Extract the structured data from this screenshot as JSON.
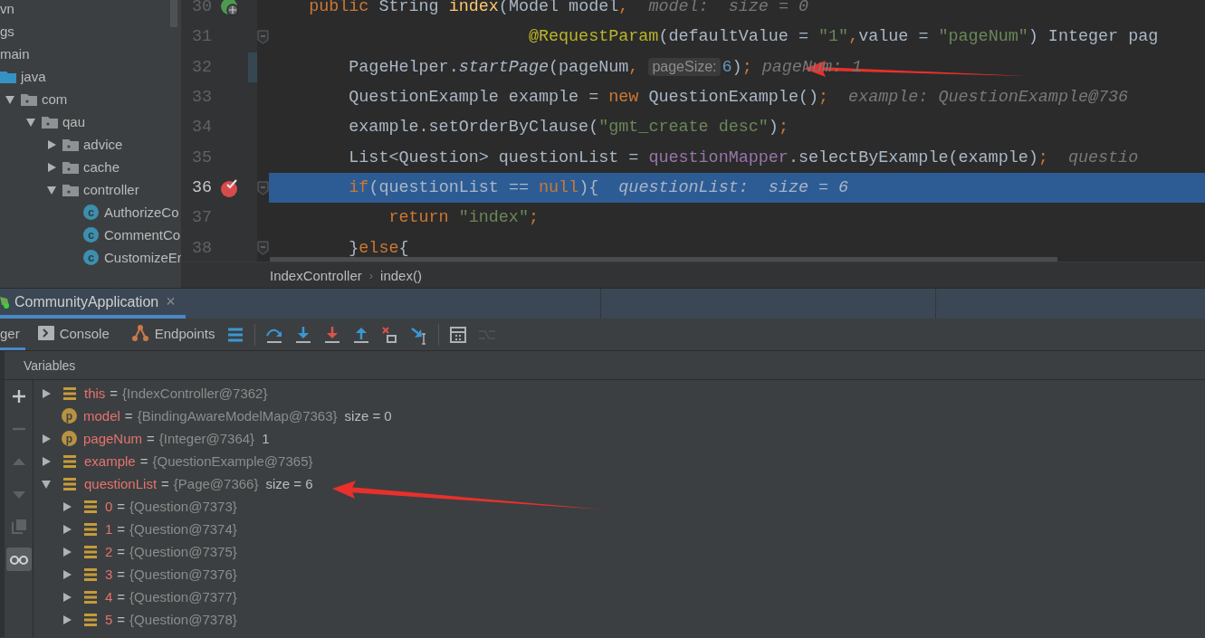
{
  "sidebar": {
    "tree": [
      {
        "label": "vn"
      },
      {
        "label": "gs"
      },
      {
        "label": "main",
        "children": [
          {
            "label": "java",
            "kind": "source_root",
            "children": [
              {
                "label": "com",
                "kind": "package",
                "expanded": true,
                "children": [
                  {
                    "label": "qau",
                    "kind": "package",
                    "expanded": true,
                    "children": [
                      {
                        "label": "advice",
                        "kind": "package",
                        "expanded": false
                      },
                      {
                        "label": "cache",
                        "kind": "package",
                        "expanded": false
                      },
                      {
                        "label": "controller",
                        "kind": "package",
                        "expanded": true,
                        "children": [
                          {
                            "label": "AuthorizeCo",
                            "kind": "class",
                            "badge": "c"
                          },
                          {
                            "label": "CommentCo",
                            "kind": "class",
                            "badge": "c"
                          },
                          {
                            "label": "CustomizeEr",
                            "kind": "class",
                            "badge": "c"
                          }
                        ]
                      }
                    ]
                  }
                ]
              }
            ]
          }
        ]
      }
    ]
  },
  "editor": {
    "lines": [
      {
        "number": "30",
        "kind": "endpoint",
        "changed": false,
        "fold": false,
        "current": false,
        "tokens": [
          {
            "text": "    public ",
            "kind": "keyword"
          },
          {
            "text": "String ",
            "kind": "plain"
          },
          {
            "text": "index",
            "kind": "method"
          },
          {
            "text": "(Model model",
            "kind": "plain"
          },
          {
            "text": ",",
            "kind": "punct"
          },
          {
            "text": "  model:  size = 0",
            "kind": "hint"
          }
        ]
      },
      {
        "number": "31",
        "kind": "plain",
        "changed": false,
        "fold": true,
        "current": false,
        "tokens": [
          {
            "text": "                          @RequestParam",
            "kind": "annotation"
          },
          {
            "text": "(defaultValue = ",
            "kind": "plain"
          },
          {
            "text": "\"1\"",
            "kind": "string"
          },
          {
            "text": ",",
            "kind": "punct"
          },
          {
            "text": "value = ",
            "kind": "plain"
          },
          {
            "text": "\"pageNum\"",
            "kind": "string"
          },
          {
            "text": ") Integer pag",
            "kind": "plain"
          }
        ]
      },
      {
        "number": "32",
        "kind": "plain",
        "changed": true,
        "fold": false,
        "current": false,
        "tokens": [
          {
            "text": "        PageHelper.",
            "kind": "plain"
          },
          {
            "text": "startPage",
            "kind": "italic"
          },
          {
            "text": "(pageNum",
            "kind": "plain"
          },
          {
            "text": ", ",
            "kind": "punct"
          },
          {
            "text": "pageSize:",
            "kind": "param_hint"
          },
          {
            "text": "6",
            "kind": "number"
          },
          {
            "text": ")",
            "kind": "plain"
          },
          {
            "text": ";",
            "kind": "punct"
          },
          {
            "text": " pageNum: 1",
            "kind": "hint"
          }
        ]
      },
      {
        "number": "33",
        "kind": "plain",
        "changed": false,
        "fold": false,
        "current": false,
        "tokens": [
          {
            "text": "        QuestionExample example = ",
            "kind": "plain"
          },
          {
            "text": "new",
            "kind": "keyword"
          },
          {
            "text": " QuestionExample()",
            "kind": "plain"
          },
          {
            "text": ";",
            "kind": "punct"
          },
          {
            "text": "  example: QuestionExample@736",
            "kind": "hint"
          }
        ]
      },
      {
        "number": "34",
        "kind": "plain",
        "changed": false,
        "fold": false,
        "current": false,
        "tokens": [
          {
            "text": "        example.setOrderByClause(",
            "kind": "plain"
          },
          {
            "text": "\"gmt_create desc\"",
            "kind": "string"
          },
          {
            "text": ")",
            "kind": "plain"
          },
          {
            "text": ";",
            "kind": "punct"
          }
        ]
      },
      {
        "number": "35",
        "kind": "plain",
        "changed": false,
        "fold": false,
        "current": false,
        "tokens": [
          {
            "text": "        List<Question> questionList = ",
            "kind": "plain"
          },
          {
            "text": "questionMapper",
            "kind": "field"
          },
          {
            "text": ".selectByExample(example)",
            "kind": "plain"
          },
          {
            "text": ";",
            "kind": "punct"
          },
          {
            "text": "  questio",
            "kind": "hint"
          }
        ]
      },
      {
        "number": "36",
        "kind": "breakpoint",
        "changed": false,
        "fold": true,
        "current": true,
        "tokens": [
          {
            "text": "        if",
            "kind": "keyword"
          },
          {
            "text": "(questionList == ",
            "kind": "plain"
          },
          {
            "text": "null",
            "kind": "keyword"
          },
          {
            "text": "){",
            "kind": "plain"
          },
          {
            "text": "  questionList:  size = 6",
            "kind": "hint"
          }
        ]
      },
      {
        "number": "37",
        "kind": "plain",
        "changed": false,
        "fold": false,
        "current": false,
        "tokens": [
          {
            "text": "            return ",
            "kind": "keyword"
          },
          {
            "text": "\"index\"",
            "kind": "string"
          },
          {
            "text": ";",
            "kind": "punct"
          }
        ]
      },
      {
        "number": "38",
        "kind": "plain",
        "changed": false,
        "fold": true,
        "current": false,
        "tokens": [
          {
            "text": "        }",
            "kind": "plain"
          },
          {
            "text": "else",
            "kind": "keyword"
          },
          {
            "text": "{",
            "kind": "plain"
          }
        ]
      }
    ],
    "breadcrumb": [
      "IndexController",
      "›",
      "index()"
    ]
  },
  "run_tabs": [
    {
      "label": "CommunityApplication",
      "close": "×",
      "selected": true
    }
  ],
  "debug_tabs": [
    {
      "label": "ger",
      "kind": "plain",
      "selected": true
    },
    {
      "label": "Console",
      "kind": "console",
      "selected": false
    },
    {
      "label": "Endpoints",
      "kind": "endpoints",
      "selected": false
    }
  ],
  "debug_tool_groups": [
    {
      "tools": [
        {
          "kind": "frames",
          "disabled": false
        }
      ]
    },
    {
      "tools": [
        {
          "kind": "step_over",
          "disabled": false
        },
        {
          "kind": "step_into",
          "disabled": false
        },
        {
          "kind": "force_step_into",
          "disabled": false
        },
        {
          "kind": "step_out",
          "disabled": false
        },
        {
          "kind": "drop_frame",
          "disabled": false
        },
        {
          "kind": "run_to_cursor",
          "disabled": false
        }
      ]
    },
    {
      "tools": [
        {
          "kind": "evaluate",
          "disabled": false
        },
        {
          "kind": "trace",
          "disabled": true
        }
      ]
    }
  ],
  "variables": {
    "title": "Variables",
    "side_tools": [
      {
        "kind": "add",
        "disabled": false,
        "selected": false
      },
      {
        "kind": "remove",
        "disabled": true,
        "selected": false
      },
      {
        "kind": "up",
        "disabled": true,
        "selected": false
      },
      {
        "kind": "down",
        "disabled": true,
        "selected": false
      },
      {
        "kind": "copy",
        "disabled": true,
        "selected": false
      },
      {
        "kind": "glasses",
        "disabled": false,
        "selected": true
      }
    ],
    "items": [
      {
        "name": "this",
        "kind": "field",
        "sep": "=",
        "ref": "{IndexController@7362}",
        "expanded": false
      },
      {
        "name": "model",
        "kind": "param",
        "badge": "p",
        "sep": "=",
        "ref": "{BindingAwareModelMap@7363}",
        "value": "size = 0"
      },
      {
        "name": "pageNum",
        "kind": "param",
        "badge": "p",
        "sep": "=",
        "ref": "{Integer@7364}",
        "value": "1",
        "expanded": false
      },
      {
        "name": "example",
        "kind": "field",
        "sep": "=",
        "ref": "{QuestionExample@7365}",
        "expanded": false
      },
      {
        "name": "questionList",
        "kind": "field",
        "sep": "=",
        "ref": "{Page@7366}",
        "value": "size = 6",
        "expanded": true,
        "children": [
          {
            "name": "0",
            "kind": "field",
            "sep": "=",
            "ref": "{Question@7373}",
            "expanded": false
          },
          {
            "name": "1",
            "kind": "field",
            "sep": "=",
            "ref": "{Question@7374}",
            "expanded": false
          },
          {
            "name": "2",
            "kind": "field",
            "sep": "=",
            "ref": "{Question@7375}",
            "expanded": false
          },
          {
            "name": "3",
            "kind": "field",
            "sep": "=",
            "ref": "{Question@7376}",
            "expanded": false
          },
          {
            "name": "4",
            "kind": "field",
            "sep": "=",
            "ref": "{Question@7377}",
            "expanded": false
          },
          {
            "name": "5",
            "kind": "field",
            "sep": "=",
            "ref": "{Question@7378}",
            "expanded": false
          }
        ]
      }
    ]
  }
}
